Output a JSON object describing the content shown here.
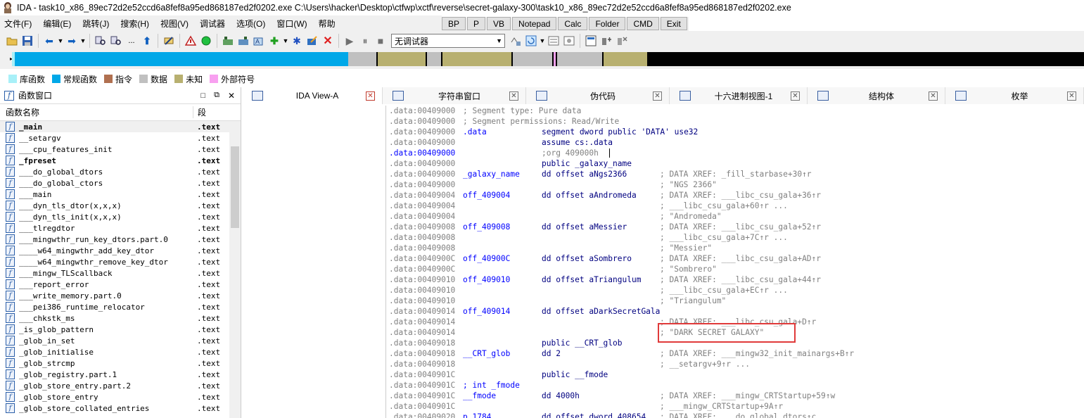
{
  "window": {
    "title": "IDA - task10_x86_89ec72d2e52ccd6a8fef8a95ed868187ed2f0202.exe C:\\Users\\hacker\\Desktop\\ctfwp\\xctf\\reverse\\secret-galaxy-300\\task10_x86_89ec72d2e52ccd6a8fef8a95ed868187ed2f0202.exe"
  },
  "menu": [
    "文件(F)",
    "编辑(E)",
    "跳转(J)",
    "搜索(H)",
    "视图(V)",
    "调试器",
    "选项(O)",
    "窗口(W)",
    "帮助"
  ],
  "quick_buttons": [
    "BP",
    "P",
    "VB",
    "Notepad",
    "Calc",
    "Folder",
    "CMD",
    "Exit"
  ],
  "toolbar": {
    "debugger_select": "无调试器"
  },
  "legend": [
    {
      "label": "库函数",
      "color": "#a8f0f8"
    },
    {
      "label": "常规函数",
      "color": "#00a8e8"
    },
    {
      "label": "指令",
      "color": "#b07050"
    },
    {
      "label": "数据",
      "color": "#c0c0c0"
    },
    {
      "label": "未知",
      "color": "#b8b070"
    },
    {
      "label": "外部符号",
      "color": "#f8a0f0"
    }
  ],
  "functions_panel": {
    "title": "函数窗口",
    "col_name": "函数名称",
    "col_segment": "段",
    "rows": [
      {
        "name": "_main",
        "seg": ".text",
        "bold": true
      },
      {
        "name": "__setargv",
        "seg": ".text"
      },
      {
        "name": "___cpu_features_init",
        "seg": ".text"
      },
      {
        "name": "_fpreset",
        "seg": ".text",
        "bold": true
      },
      {
        "name": "___do_global_dtors",
        "seg": ".text"
      },
      {
        "name": "___do_global_ctors",
        "seg": ".text"
      },
      {
        "name": "___main",
        "seg": ".text"
      },
      {
        "name": "___dyn_tls_dtor(x,x,x)",
        "seg": ".text"
      },
      {
        "name": "___dyn_tls_init(x,x,x)",
        "seg": ".text"
      },
      {
        "name": "___tlregdtor",
        "seg": ".text"
      },
      {
        "name": "___mingwthr_run_key_dtors.part.0",
        "seg": ".text"
      },
      {
        "name": "____w64_mingwthr_add_key_dtor",
        "seg": ".text"
      },
      {
        "name": "____w64_mingwthr_remove_key_dtor",
        "seg": ".text"
      },
      {
        "name": "___mingw_TLScallback",
        "seg": ".text"
      },
      {
        "name": "___report_error",
        "seg": ".text"
      },
      {
        "name": "___write_memory.part.0",
        "seg": ".text"
      },
      {
        "name": "___pei386_runtime_relocator",
        "seg": ".text"
      },
      {
        "name": "___chkstk_ms",
        "seg": ".text"
      },
      {
        "name": "_is_glob_pattern",
        "seg": ".text"
      },
      {
        "name": "_glob_in_set",
        "seg": ".text"
      },
      {
        "name": "_glob_initialise",
        "seg": ".text"
      },
      {
        "name": "_glob_strcmp",
        "seg": ".text"
      },
      {
        "name": "_glob_registry.part.1",
        "seg": ".text"
      },
      {
        "name": "_glob_store_entry.part.2",
        "seg": ".text"
      },
      {
        "name": "_glob_store_entry",
        "seg": ".text"
      },
      {
        "name": "_glob_store_collated_entries",
        "seg": ".text"
      }
    ]
  },
  "tabs": [
    {
      "label": "IDA View-A",
      "active": true
    },
    {
      "label": "字符串窗口"
    },
    {
      "label": "伪代码"
    },
    {
      "label": "十六进制视图-1"
    },
    {
      "label": "结构体"
    },
    {
      "label": "枚举"
    }
  ],
  "disasm": [
    {
      "addr": ".data:00409000",
      "full": "; Segment type: Pure data"
    },
    {
      "addr": ".data:00409000",
      "full": "; Segment permissions: Read/Write"
    },
    {
      "addr": ".data:00409000",
      "label": ".data",
      "ins": "segment dword public 'DATA' use32"
    },
    {
      "addr": ".data:00409000",
      "ins": "assume cs:.data"
    },
    {
      "addr": ".data:00409000",
      "ins": ";org 409000h",
      "hl": true,
      "cursor": true
    },
    {
      "addr": ".data:00409000",
      "ins": "public _galaxy_name"
    },
    {
      "addr": ".data:00409000",
      "label": "_galaxy_name",
      "ins": "dd offset aNgs2366",
      "cmt": "; DATA XREF: _fill_starbase+30↑r",
      "dot": true
    },
    {
      "addr": ".data:00409000",
      "cmt": "; \"NGS 2366\""
    },
    {
      "addr": ".data:00409004",
      "label": "off_409004",
      "ins": "dd offset aAndromeda",
      "cmt": "; DATA XREF: ___libc_csu_gala+36↑r",
      "dot": true
    },
    {
      "addr": ".data:00409004",
      "cmt": "; ___libc_csu_gala+60↑r ..."
    },
    {
      "addr": ".data:00409004",
      "cmt": "; \"Andromeda\""
    },
    {
      "addr": ".data:00409008",
      "label": "off_409008",
      "ins": "dd offset aMessier",
      "cmt": "; DATA XREF: ___libc_csu_gala+52↑r",
      "dot": true
    },
    {
      "addr": ".data:00409008",
      "cmt": "; ___libc_csu_gala+7C↑r ..."
    },
    {
      "addr": ".data:00409008",
      "cmt": "; \"Messier\""
    },
    {
      "addr": ".data:0040900C",
      "label": "off_40900C",
      "ins": "dd offset aSombrero",
      "cmt": "; DATA XREF: ___libc_csu_gala+AD↑r",
      "dot": true
    },
    {
      "addr": ".data:0040900C",
      "cmt": "; \"Sombrero\""
    },
    {
      "addr": ".data:00409010",
      "label": "off_409010",
      "ins": "dd offset aTriangulum",
      "cmt": "; DATA XREF: ___libc_csu_gala+44↑r",
      "dot": true
    },
    {
      "addr": ".data:00409010",
      "cmt": "; ___libc_csu_gala+EC↑r ..."
    },
    {
      "addr": ".data:00409010",
      "cmt": "; \"Triangulum\""
    },
    {
      "addr": ".data:00409014",
      "label": "off_409014",
      "ins": "dd offset aDarkSecretGala",
      "dot": true
    },
    {
      "addr": ".data:00409014",
      "cmt": "; DATA XREF: ___libc_csu_gala+D↑r"
    },
    {
      "addr": ".data:00409014",
      "cmt": "; \"DARK SECRET GALAXY\""
    },
    {
      "addr": ".data:00409018",
      "ins": "public __CRT_glob"
    },
    {
      "addr": ".data:00409018",
      "label": "__CRT_glob",
      "ins": "dd 2",
      "cmt": "; DATA XREF: ___mingw32_init_mainargs+B↑r",
      "dot": true
    },
    {
      "addr": ".data:00409018",
      "cmt": "; __setargv+9↑r ..."
    },
    {
      "addr": ".data:0040901C",
      "ins": "public __fmode"
    },
    {
      "addr": ".data:0040901C",
      "label": "; int _fmode"
    },
    {
      "addr": ".data:0040901C",
      "label": "__fmode",
      "ins": "dd 4000h",
      "cmt": "; DATA XREF: ___mingw_CRTStartup+59↑w",
      "dot": true
    },
    {
      "addr": ".data:0040901C",
      "cmt": "; ___mingw_CRTStartup+9A↑r"
    },
    {
      "addr": ".data:00409020",
      "label": "p_1784",
      "ins": "dd offset dword_408654",
      "cmt": "; DATA XREF: ___do_global_dtors↑c",
      "dot": true
    }
  ]
}
